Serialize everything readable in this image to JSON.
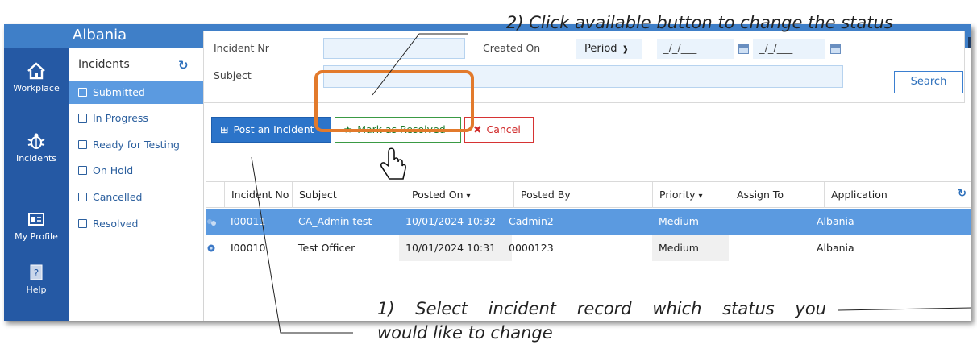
{
  "app": {
    "country": "Albania"
  },
  "nav": [
    {
      "label": "Workplace",
      "icon": "home-icon"
    },
    {
      "label": "Incidents",
      "icon": "bug-icon"
    },
    {
      "label": "My Profile",
      "icon": "profile-card-icon"
    },
    {
      "label": "Help",
      "icon": "help-icon"
    }
  ],
  "status_panel": {
    "title": "Incidents",
    "items": [
      "Submitted",
      "In Progress",
      "Ready for Testing",
      "On Hold",
      "Cancelled",
      "Resolved"
    ],
    "active": "Submitted"
  },
  "filters": {
    "incident_nr_label": "Incident Nr",
    "incident_nr_value": "",
    "subject_label": "Subject",
    "subject_value": "",
    "created_on_label": "Created On",
    "period_value": "Period",
    "date_from": "_/_/___",
    "date_to": "_/_/___",
    "search_label": "Search"
  },
  "actions": {
    "post_label": "Post an Incident",
    "resolve_label": "Mark as Resolved",
    "cancel_label": "Cancel"
  },
  "grid": {
    "columns": [
      "Incident No",
      "Subject",
      "Posted On",
      "Posted By",
      "Priority",
      "Assign To",
      "Application"
    ],
    "rows": [
      {
        "no": "I00011",
        "subject": "CA_Admin test",
        "posted_on": "10/01/2024 10:32",
        "posted_by": "Cadmin2",
        "priority": "Medium",
        "assign_to": "",
        "application": "Albania",
        "selected": true
      },
      {
        "no": "I00010",
        "subject": "Test Officer",
        "posted_on": "10/01/2024 10:31",
        "posted_by": "0000123",
        "priority": "Medium",
        "assign_to": "",
        "application": "Albania",
        "selected": false
      }
    ]
  },
  "annotations": {
    "step2": "2) Click available button to change the status",
    "step1_line1": "1) Select incident record which status you",
    "step1_line2": "would like to change"
  },
  "colors": {
    "titlebar": "#3f7fc8",
    "nav": "#2559a4",
    "selection": "#5b9ae0",
    "highlight": "#e27a2c",
    "resolve_green": "#3a9a44",
    "cancel_red": "#d63333"
  }
}
